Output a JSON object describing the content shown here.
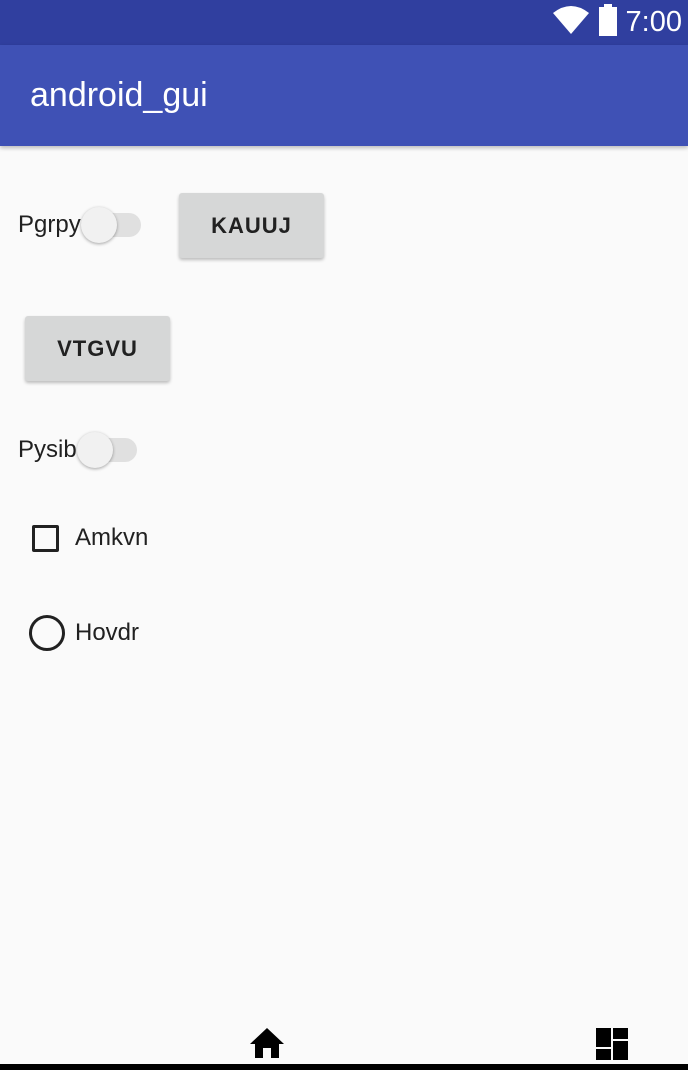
{
  "status_bar": {
    "time": "7:00",
    "icons": [
      "wifi-icon",
      "battery-icon"
    ]
  },
  "app_bar": {
    "title": "android_gui"
  },
  "content": {
    "switch1": {
      "label": "Pgrpy",
      "checked": false
    },
    "button1": {
      "label": "KAUUJ"
    },
    "button2": {
      "label": "VTGVU"
    },
    "switch2": {
      "label": "Pysib",
      "checked": false
    },
    "checkbox1": {
      "label": "Amkvn",
      "checked": false
    },
    "radio1": {
      "label": "Hovdr",
      "checked": false
    }
  },
  "nav_bar": {
    "icons": [
      "home-icon",
      "dashboard-icon"
    ]
  },
  "colors": {
    "status_bar": "#303f9f",
    "app_bar": "#3f51b5",
    "background": "#fafafa",
    "button": "#d6d7d7"
  }
}
